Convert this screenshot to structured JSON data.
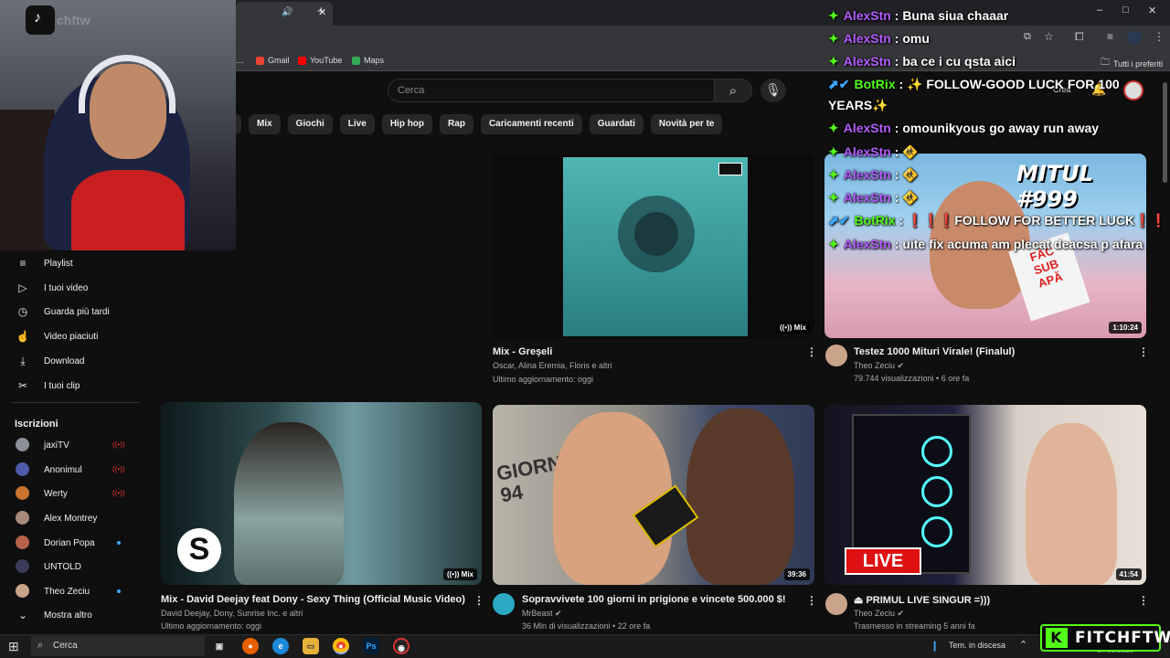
{
  "browser": {
    "window_controls": [
      "–",
      "□",
      "✕"
    ],
    "bookmarks": [
      {
        "label": "Gmail",
        "color": "#ea4335"
      },
      {
        "label": "YouTube",
        "color": "#ff0000"
      },
      {
        "label": "Maps",
        "color": "#34a853"
      }
    ],
    "all_bookmarks": "Tutti i preferiti"
  },
  "youtube": {
    "search_placeholder": "Cerca",
    "create_label": "Crea",
    "chips": [
      "Mix",
      "Giochi",
      "Live",
      "Hip hop",
      "Rap",
      "Caricamenti recenti",
      "Guardati",
      "Novità per te"
    ],
    "sidebar": {
      "items": [
        {
          "label": "Playlist",
          "icon": "≡"
        },
        {
          "label": "I tuoi video",
          "icon": "▷"
        },
        {
          "label": "Guarda più tardi",
          "icon": "◷"
        },
        {
          "label": "Video piaciuti",
          "icon": "☝"
        },
        {
          "label": "Download",
          "icon": "⤓"
        },
        {
          "label": "I tuoi clip",
          "icon": "✂"
        }
      ],
      "subscriptions_title": "Iscrizioni",
      "subscriptions": [
        {
          "name": "jaxiTV",
          "status": "live",
          "color": "#8a8f9a"
        },
        {
          "name": "Anonimul",
          "status": "live",
          "color": "#4c5aa8"
        },
        {
          "name": "Werty",
          "status": "live",
          "color": "#c9752e"
        },
        {
          "name": "Alex Montrey",
          "status": "",
          "color": "#a88a7a"
        },
        {
          "name": "Dorian Popa",
          "status": "new",
          "color": "#b8614a"
        },
        {
          "name": "UNTOLD",
          "status": "",
          "color": "#3b3b5a"
        },
        {
          "name": "Theo Zeciu",
          "status": "new",
          "color": "#c9a48a"
        }
      ],
      "show_more": "Mostra altro"
    },
    "videos": [
      {
        "title": "Mix - Greșeli",
        "line1": "Oscar, Alina Eremia, Floris e altri",
        "line2": "Ultimo aggiornamento: oggi",
        "badge": "Mix",
        "kind": "mix"
      },
      {
        "title": "Testez 1000 Mituri Virale! (Finalul)",
        "line1": "Theo Zeciu ✔",
        "line2": "79.744 visualizzazioni • 6 ore fa",
        "badge": "1:10:24",
        "thumb_text": "MITUL #999",
        "sign": "FĂC\nSUB\nAPĂ"
      },
      {
        "title": "Mix - David Deejay feat Dony  - Sexy Thing (Official Music Video)",
        "line1": "David Deejay, Dony, Sunrise Inc. e altri",
        "line2": "Ultimo aggiornamento: oggi",
        "badge": "Mix",
        "kind": "mix"
      },
      {
        "title": "Sopravvivete 100 giorni in prigione e vincete 500.000 $!",
        "line1": "MrBeast ✔",
        "line2": "36 Mln di visualizzazioni • 22 ore fa",
        "badge": "39:36",
        "thumb_text": "GIORNO\n94"
      },
      {
        "title": "⏏ PRIMUL LIVE SINGUR =)))",
        "line1": "Theo Zeciu ✔",
        "line2": "Trasmesso in streaming 5 anni fa",
        "badge": "41:54",
        "thumb_text": "LIVE"
      }
    ]
  },
  "chat": [
    {
      "user": "AlexStn",
      "msg": "Buna siua chaaar",
      "bot": false
    },
    {
      "user": "AlexStn",
      "msg": "omu",
      "bot": false
    },
    {
      "user": "AlexStn",
      "msg": "ba ce i cu qsta aici",
      "bot": false
    },
    {
      "user": "BotRix",
      "msg": "✨ FOLLOW-GOOD LUCK FOR 100",
      "msg2": "YEARS✨",
      "bot": true
    },
    {
      "user": "AlexStn",
      "msg": "omounikyous go away run away",
      "bot": false
    },
    {
      "user": "AlexStn",
      "msg": "🚸",
      "bot": false
    },
    {
      "user": "AlexStn",
      "msg": "🚸",
      "bot": false
    },
    {
      "user": "AlexStn",
      "msg": "🚸",
      "bot": false
    },
    {
      "user": "BotRix",
      "msg": "❗❗❗FOLLOW FOR BETTER LUCK❗❗❗",
      "bot": true
    },
    {
      "user": "AlexStn",
      "msg": "uite fix acuma am plecat deacsa p afara",
      "bot": false
    }
  ],
  "overlay": {
    "webcam_watermark": "chftw",
    "brand": "FITCHFTW",
    "brand_letter": "K"
  },
  "taskbar": {
    "search_placeholder": "Cerca",
    "weather": "Tem. in discesa",
    "date": "17/08/2025"
  }
}
